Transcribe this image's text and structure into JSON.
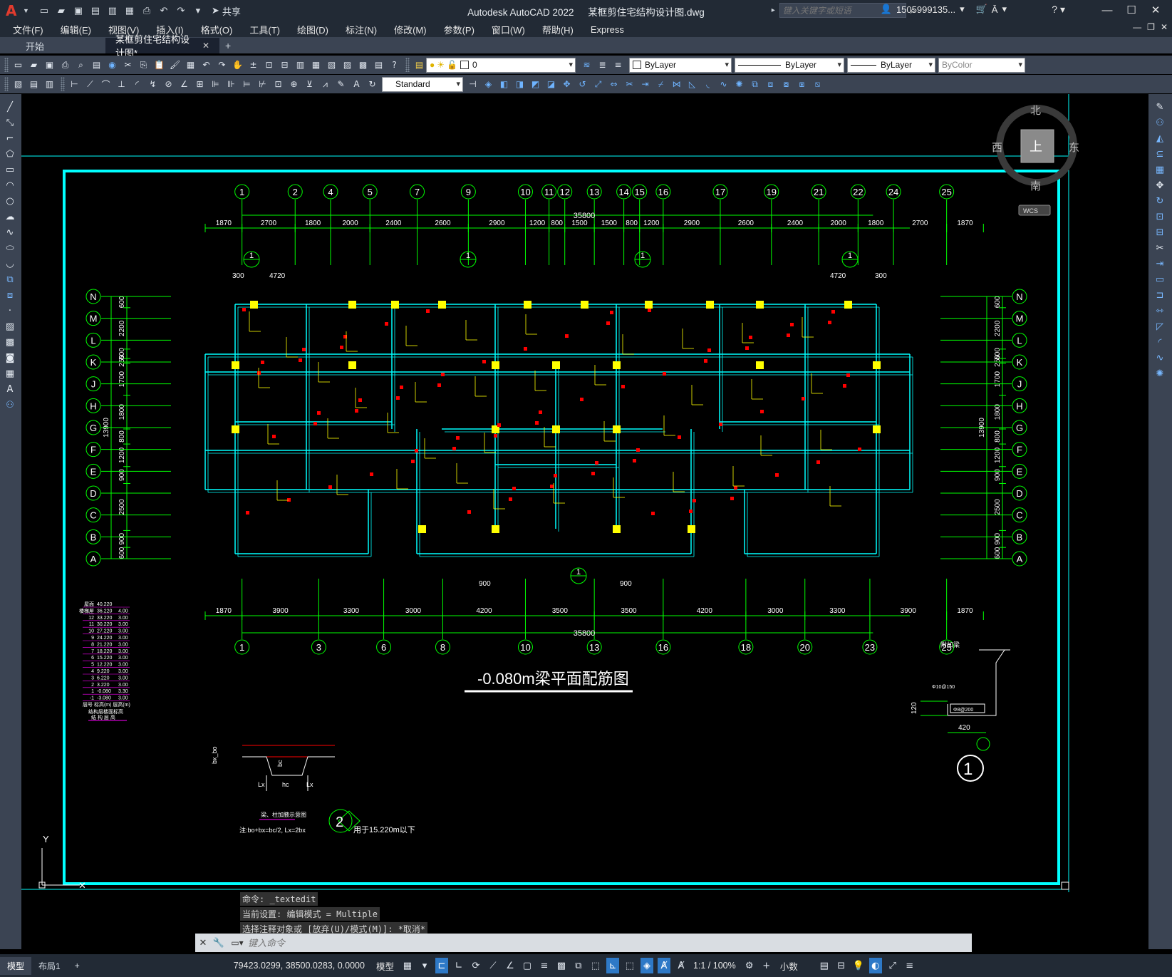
{
  "titlebar": {
    "app_name": "Autodesk AutoCAD 2022",
    "file_name": "某框剪住宅结构设计图.dwg",
    "share_label": "共享",
    "search_placeholder": "键入关键字或短语",
    "user_name": "1505999135...",
    "win_min": "—",
    "win_restore": "☐",
    "win_close": "✕"
  },
  "menu": [
    "文件(F)",
    "编辑(E)",
    "视图(V)",
    "插入(I)",
    "格式(O)",
    "工具(T)",
    "绘图(D)",
    "标注(N)",
    "修改(M)",
    "参数(P)",
    "窗口(W)",
    "帮助(H)",
    "Express"
  ],
  "tabs": {
    "start": "开始",
    "active": "某框剪住宅结构设计图*"
  },
  "toolbar": {
    "layer_value": "0",
    "color_value": "ByLayer",
    "linetype_value": "ByLayer",
    "lineweight_value": "ByLayer",
    "plotstyle_value": "ByColor",
    "textstyle_value": "Standard"
  },
  "viewcube": {
    "north": "北",
    "south": "南",
    "east": "东",
    "west": "西",
    "top": "上",
    "wcs": "WCS"
  },
  "drawing": {
    "title": "-0.080m梁平面配筋图",
    "top_axes": [
      "1",
      "2",
      "4",
      "5",
      "7",
      "9",
      "10",
      "11",
      "12",
      "13",
      "14",
      "15",
      "16",
      "17",
      "19",
      "21",
      "22",
      "24",
      "25"
    ],
    "top_dims": [
      "1870",
      "2700",
      "1800",
      "2000",
      "2400",
      "2600",
      "2900",
      "1200",
      "800",
      "1500",
      "1500",
      "800",
      "1200",
      "2900",
      "2600",
      "2400",
      "2000",
      "1800",
      "2700",
      "1870"
    ],
    "bottom_axes": [
      "1",
      "3",
      "6",
      "8",
      "10",
      "13",
      "16",
      "18",
      "20",
      "23",
      "25"
    ],
    "bottom_dims": [
      "1870",
      "3900",
      "3300",
      "3000",
      "4200",
      "3500",
      "3500",
      "4200",
      "3000",
      "3300",
      "3900",
      "1870"
    ],
    "overall_dim": "35800",
    "row_axes": [
      "N",
      "M",
      "L",
      "K",
      "J",
      "H",
      "G",
      "F",
      "E",
      "D",
      "C",
      "B",
      "A"
    ],
    "side_dims": [
      "600",
      "2200",
      "500",
      "250",
      "1700",
      "1800",
      "800",
      "1200",
      "900",
      "2500",
      "900",
      "600"
    ],
    "side_total": "13900",
    "sec_left_300": "300",
    "sec_left_4720": "4720",
    "sec_right_4720": "4720",
    "sec_right_300": "300",
    "dim_900": "900",
    "section_tag": "1",
    "detail_circle": "1",
    "detail_420": "420",
    "detail_120": "120",
    "detail_label": "附加梁",
    "detail_note1": "Φ10@150",
    "detail_note2": "Φ8@200",
    "callout2": "2",
    "callout2_text": "用于15.220m以下",
    "haunch_note": "注:bo+bx=bc/2,  Lx=2bx",
    "haunch_title": "梁、柱加腋示意图",
    "haunch_lx": "Lx",
    "haunch_hc": "hc",
    "haunch_bc": "bc",
    "haunch_bx": "bx_bo",
    "floor_table_title": "结构层楼面标高",
    "floor_table_sub": "结 构 层 高",
    "floor_table_header": [
      "层号",
      "标高(m)",
      "层高(m)"
    ],
    "floor_rows": [
      [
        "屋面",
        "40.220",
        ""
      ],
      [
        "楼梯屋",
        "36.220",
        "4.00"
      ],
      [
        "12",
        "33.220",
        "3.00"
      ],
      [
        "11",
        "30.220",
        "3.00"
      ],
      [
        "10",
        "27.220",
        "3.00"
      ],
      [
        "9",
        "24.220",
        "3.00"
      ],
      [
        "8",
        "21.220",
        "3.00"
      ],
      [
        "7",
        "18.220",
        "3.00"
      ],
      [
        "6",
        "15.220",
        "3.00"
      ],
      [
        "5",
        "12.220",
        "3.00"
      ],
      [
        "4",
        "9.220",
        "3.00"
      ],
      [
        "3",
        "6.220",
        "3.00"
      ],
      [
        "2",
        "3.220",
        "3.00"
      ],
      [
        "1",
        "-0.080",
        "3.30"
      ],
      [
        "-1",
        "-3.080",
        "3.00"
      ]
    ]
  },
  "command": {
    "history": [
      "命令: _textedit",
      "当前设置: 编辑模式 = Multiple",
      "选择注释对象或 [放弃(U)/模式(M)]: *取消*"
    ],
    "placeholder": "键入命令"
  },
  "statusbar": {
    "tab_model": "模型",
    "tab_layout": "布局1",
    "tab_add": "+",
    "coords": "79423.0299, 38500.0283, 0.0000",
    "model_label": "模型",
    "scale": "1:1 / 100%",
    "units": "小数"
  },
  "colors": {
    "ui_dark": "#222a35",
    "ui_panel": "#3b4453",
    "cad_cyan": "#00ffff",
    "cad_green": "#00ff00",
    "cad_yellow": "#ffff00",
    "cad_red": "#ff0000",
    "cad_magenta": "#ff00ff",
    "cad_white": "#ffffff"
  }
}
